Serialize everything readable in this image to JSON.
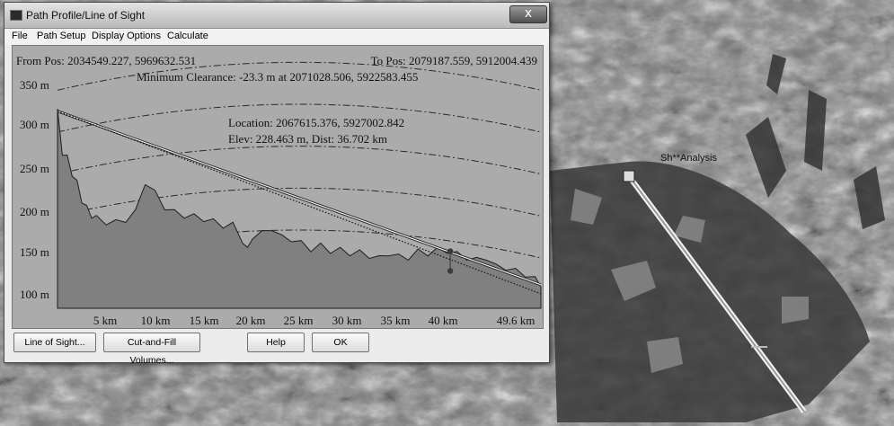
{
  "window": {
    "title": "Path Profile/Line of Sight",
    "close_glyph": "x"
  },
  "menu": {
    "items": [
      "File",
      "Path Setup",
      "Display Options",
      "Calculate"
    ]
  },
  "profile": {
    "from_pos": "From Pos: 2034549.227, 5969632.531",
    "to_pos": "To Pos: 2079187.559, 5912004.439",
    "min_clearance": "Minimum Clearance: -23.3 m at 2071028.506, 5922583.455",
    "location": "Location: 2067615.376, 5927002.842",
    "elev_dist": "Elev: 228.463 m, Dist: 36.702 km",
    "y_labels": [
      "350 m",
      "300 m",
      "250 m",
      "200 m",
      "150 m",
      "100 m"
    ],
    "x_labels": [
      "5 km",
      "10 km",
      "15 km",
      "20 km",
      "25 km",
      "30 km",
      "35 km",
      "40 km",
      "49.6 km"
    ]
  },
  "chart_data": {
    "type": "area",
    "x": [
      0,
      0.5,
      1,
      1.5,
      2,
      2.5,
      3,
      3.5,
      4,
      5,
      6,
      7,
      8,
      9,
      10,
      11,
      12,
      13,
      14,
      15,
      16,
      17,
      18,
      19,
      19.5,
      20,
      21,
      22,
      23,
      24,
      25,
      26,
      27,
      28,
      29,
      30,
      31,
      32,
      33,
      34,
      35,
      36,
      37,
      38,
      39,
      40,
      41,
      42,
      43,
      44,
      45,
      46,
      47,
      48,
      49,
      49.6
    ],
    "y": [
      325,
      275,
      270,
      250,
      240,
      218,
      210,
      200,
      198,
      192,
      193,
      195,
      205,
      240,
      228,
      210,
      205,
      200,
      200,
      196,
      194,
      188,
      190,
      170,
      160,
      175,
      180,
      185,
      175,
      172,
      168,
      160,
      165,
      158,
      160,
      155,
      157,
      152,
      150,
      155,
      152,
      150,
      158,
      155,
      160,
      158,
      155,
      150,
      148,
      150,
      140,
      138,
      135,
      130,
      125,
      118
    ],
    "xlim": [
      0,
      49.6
    ],
    "ylim": [
      90,
      360
    ],
    "xlabel": "",
    "ylabel": "",
    "grid": true,
    "line_of_sight": {
      "start": [
        0,
        325
      ],
      "end": [
        49.6,
        118
      ]
    },
    "marker": {
      "x": 40.3,
      "y": 158
    }
  },
  "buttons": {
    "line_of_sight": "Line of Sight...",
    "cut_fill": "Cut-and-Fill Volumes...",
    "help": "Help",
    "ok": "OK"
  },
  "map": {
    "label": "Sh**Analysis"
  }
}
